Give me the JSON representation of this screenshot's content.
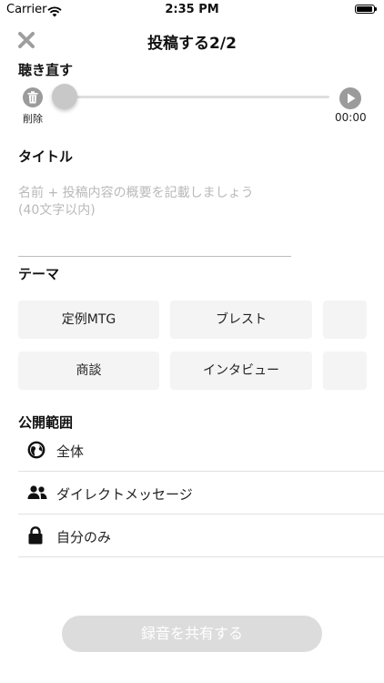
{
  "status_bar": {
    "carrier": "Carrier",
    "time": "2:35 PM"
  },
  "nav": {
    "title": "投稿する2/2",
    "close_icon": "close-icon"
  },
  "listen_again": {
    "label": "聴き直す",
    "delete_label": "削除",
    "duration": "00:00",
    "progress": 0
  },
  "title_section": {
    "label": "タイトル",
    "placeholder": "名前 + 投稿内容の概要を記載しましょう\n(40文字以内)",
    "value": ""
  },
  "theme_section": {
    "label": "テーマ",
    "chips": [
      "定例MTG",
      "ブレスト",
      "",
      "商談",
      "インタビュー",
      ""
    ]
  },
  "visibility_section": {
    "label": "公開範囲",
    "options": [
      {
        "label": "全体",
        "icon": "globe-icon"
      },
      {
        "label": "ダイレクトメッセージ",
        "icon": "users-icon"
      },
      {
        "label": "自分のみ",
        "icon": "lock-icon"
      }
    ]
  },
  "share_button": {
    "label": "録音を共有する",
    "enabled": false
  },
  "colors": {
    "share_button_bg": "#dcdcdc",
    "chip_bg": "#f4f4f4",
    "control_gray": "#9b9b9b"
  }
}
